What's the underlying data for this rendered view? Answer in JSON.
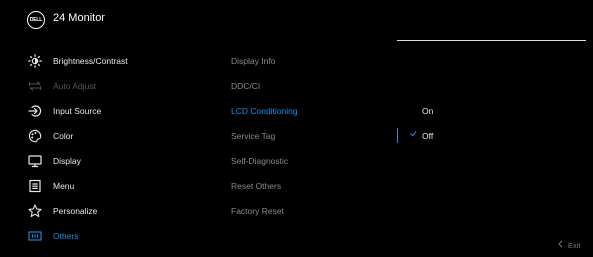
{
  "header": {
    "logo_text": "DELL",
    "title": "24 Monitor"
  },
  "menu": [
    {
      "label": "Brightness/Contrast",
      "icon": "sun-icon",
      "state": "normal"
    },
    {
      "label": "Auto Adjust",
      "icon": "auto-adjust-arrows-icon",
      "state": "disabled"
    },
    {
      "label": "Input Source",
      "icon": "input-arrow-icon",
      "state": "normal"
    },
    {
      "label": "Color",
      "icon": "palette-icon",
      "state": "normal"
    },
    {
      "label": "Display",
      "icon": "monitor-icon",
      "state": "normal"
    },
    {
      "label": "Menu",
      "icon": "menu-list-icon",
      "state": "normal"
    },
    {
      "label": "Personalize",
      "icon": "star-icon",
      "state": "normal"
    },
    {
      "label": "Others",
      "icon": "others-icon",
      "state": "active"
    }
  ],
  "submenu": [
    {
      "label": "Display Info",
      "state": "normal"
    },
    {
      "label": "DDC/CI",
      "state": "normal"
    },
    {
      "label": "LCD Conditioning",
      "state": "active"
    },
    {
      "label": "Service Tag",
      "state": "normal"
    },
    {
      "label": "Self-Diagnostic",
      "state": "normal"
    },
    {
      "label": "Reset Others",
      "state": "normal"
    },
    {
      "label": "Factory Reset",
      "state": "normal"
    }
  ],
  "options": [
    {
      "label": "On",
      "selected": false
    },
    {
      "label": "Off",
      "selected": true
    }
  ],
  "footer": {
    "exit_label": "Exit"
  },
  "colors": {
    "accent": "#1e8fe6",
    "background": "#000000"
  }
}
